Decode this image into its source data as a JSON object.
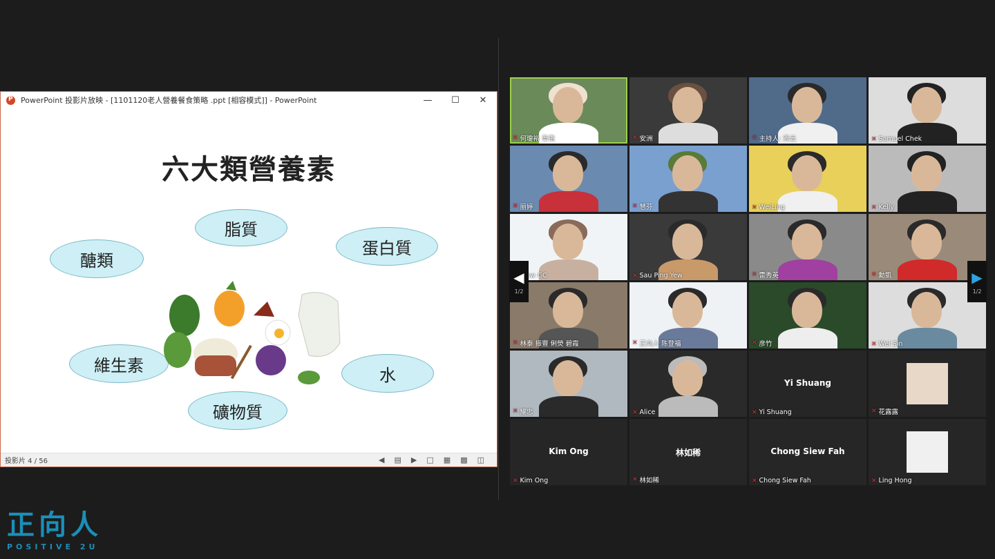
{
  "ppt_window": {
    "title": "PowerPoint 投影片放映 - [1101120老人營養餐食策略 .ppt [相容模式]] - PowerPoint",
    "controls": [
      "—",
      "☐",
      "✕"
    ],
    "slide": {
      "title": "六大類營養素",
      "bubbles": {
        "carbs": "醣類",
        "fat": "脂質",
        "protein": "蛋白質",
        "vitamins": "維生素",
        "water": "水",
        "minerals": "礦物質"
      }
    },
    "status": {
      "slide_counter": "投影片 4 / 56"
    }
  },
  "gallery": {
    "page_left": "1/2",
    "page_right": "1/2",
    "participants": [
      {
        "name": "何瓊裕 筆電",
        "type": "video"
      },
      {
        "name": "安洲",
        "type": "video"
      },
      {
        "name": "主持人: 秀云",
        "type": "video"
      },
      {
        "name": "Samuel Chek",
        "type": "video"
      },
      {
        "name": "丽婷",
        "type": "video"
      },
      {
        "name": "慧芬",
        "type": "video"
      },
      {
        "name": "WeiLing",
        "type": "video"
      },
      {
        "name": "Kelly",
        "type": "video"
      },
      {
        "name": "Siow GC",
        "type": "video"
      },
      {
        "name": "Sau Ping Yew",
        "type": "video"
      },
      {
        "name": "雷秀英",
        "type": "video"
      },
      {
        "name": "勳凱",
        "type": "video"
      },
      {
        "name": "林泰 振豐 俐熒 碧霞",
        "type": "video"
      },
      {
        "name": "正向人 陈登福",
        "type": "video"
      },
      {
        "name": "彦竹",
        "type": "video"
      },
      {
        "name": "Wei Sin",
        "type": "video"
      },
      {
        "name": "耀忠",
        "type": "video"
      },
      {
        "name": "Alice",
        "type": "video"
      },
      {
        "name": "Yi Shuang",
        "type": "name",
        "display": "Yi Shuang"
      },
      {
        "name": "花露露",
        "type": "avatar"
      },
      {
        "name": "Kim Ong",
        "type": "name",
        "display": "Kim Ong"
      },
      {
        "name": "林如稀",
        "type": "name",
        "display": "林如稀"
      },
      {
        "name": "Chong Siew Fah",
        "type": "name",
        "display": "Chong Siew Fah"
      },
      {
        "name": "Ling Hong",
        "type": "avatar"
      }
    ]
  },
  "logo": {
    "cn": "正向人",
    "en": "POSITIVE 2U"
  },
  "colors": {
    "accent": "#1a8fb8",
    "active_speaker": "#9bd04a",
    "muted": "#e0303a"
  }
}
